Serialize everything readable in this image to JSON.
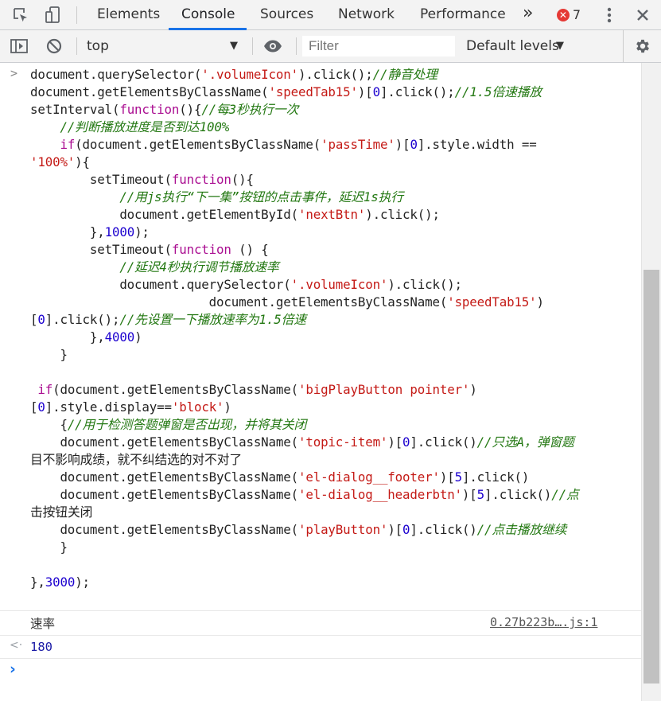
{
  "tabs": [
    "Elements",
    "Console",
    "Sources",
    "Network",
    "Performance"
  ],
  "active_tab": "Console",
  "more_tabs": "»",
  "error_count": "7",
  "toolbar": {
    "context": "top",
    "filter_placeholder": "Filter",
    "levels": "Default levels"
  },
  "code_lines": [
    "document.querySelector('.volumeIcon').click();//静音处理",
    "document.getElementsByClassName('speedTab15')[0].click();//1.5倍速播放",
    "setInterval(function(){//每3秒执行一次",
    "    //判断播放进度是否到达100%",
    "    if(document.getElementsByClassName('passTime')[0].style.width ==",
    "'100%'){",
    "        setTimeout(function(){",
    "            //用js执行“下一集”按钮的点击事件，延迟1s执行",
    "            document.getElementById('nextBtn').click();",
    "        },1000);",
    "        setTimeout(function () {",
    "            //延迟4秒执行调节播放速率",
    "            document.querySelector('.volumeIcon').click();",
    "                        document.getElementsByClassName('speedTab15')",
    "[0].click();//先设置一下播放速率为1.5倍速",
    "        },4000)",
    "    }",
    "",
    " if(document.getElementsByClassName('bigPlayButton pointer')",
    "[0].style.display=='block')",
    "    {//用于检测答题弹窗是否出现，并将其关闭",
    "    document.getElementsByClassName('topic-item')[0].click()//只选A，弹窗题",
    "目不影响成绩，就不纠结选的对不对了",
    "    document.getElementsByClassName('el-dialog__footer')[5].click()",
    "    document.getElementsByClassName('el-dialog__headerbtn')[5].click()//点",
    "击按钮关闭",
    "    document.getElementsByClassName('playButton')[0].click()//点击播放继续",
    "    }",
    "",
    "},3000);"
  ],
  "log": {
    "message": "速率",
    "source": "0.27b223b….js:1"
  },
  "result": {
    "value": "180"
  }
}
